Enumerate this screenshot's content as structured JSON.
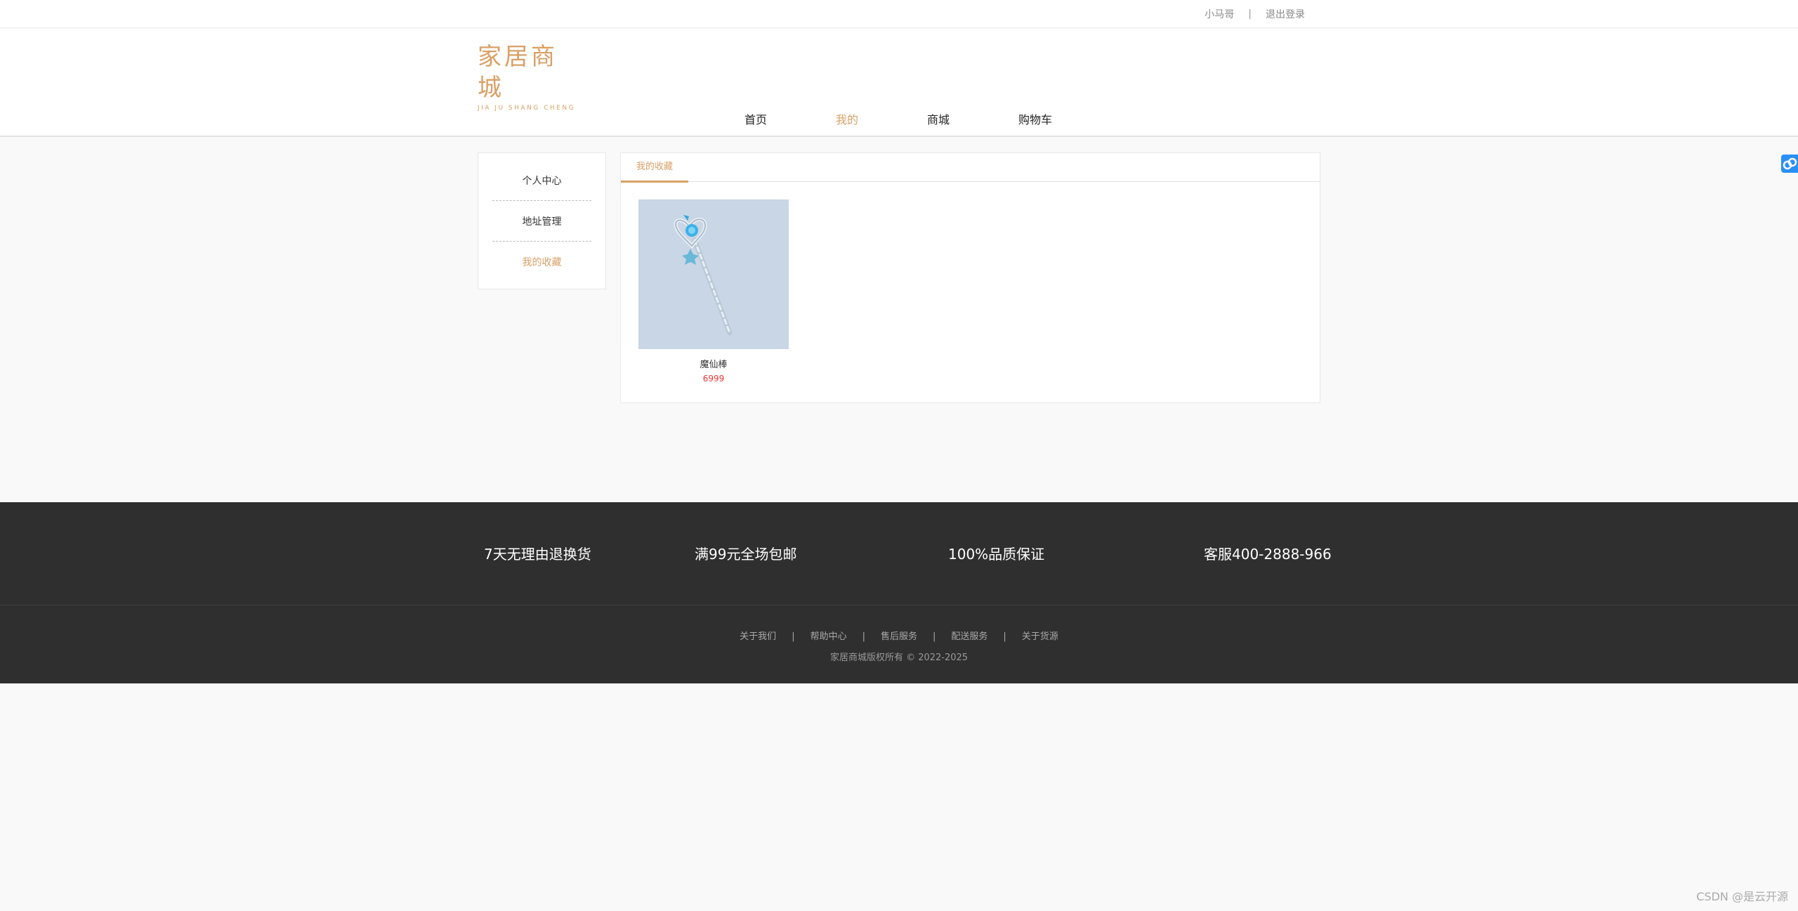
{
  "topbar": {
    "username": "小马哥",
    "separator": "|",
    "logout": "退出登录"
  },
  "logo": {
    "cn": "家居商城",
    "en": "JIA JU SHANG CHENG"
  },
  "nav": {
    "home": "首页",
    "mine": "我的",
    "mall": "商城",
    "cart": "购物车"
  },
  "sidebar": {
    "items": [
      {
        "label": "个人中心"
      },
      {
        "label": "地址管理"
      },
      {
        "label": "我的收藏"
      }
    ]
  },
  "panel": {
    "tab": "我的收藏",
    "product": {
      "name": "魔仙棒",
      "price": "6999"
    }
  },
  "footer": {
    "features": [
      "7天无理由退换货",
      "满99元全场包邮",
      "100%品质保证",
      "客服400-2888-966"
    ],
    "links": [
      "关于我们",
      "帮助中心",
      "售后服务",
      "配送服务",
      "关于货源"
    ],
    "link_separator": "|",
    "copyright": "家居商城版权所有 © 2022-2025"
  },
  "watermark": "CSDN @是云开源",
  "colors": {
    "accent": "#d9a066",
    "footer_bg": "#2f2f2f",
    "price": "#ee3333"
  }
}
